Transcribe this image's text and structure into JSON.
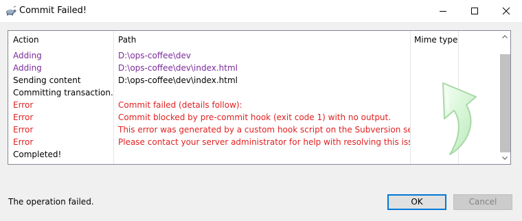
{
  "window": {
    "title": "Commit Failed!",
    "app_icon": "tortoise-icon",
    "controls": [
      "minimize-icon",
      "maximize-icon",
      "close-icon"
    ]
  },
  "list": {
    "headers": {
      "action": "Action",
      "path": "Path",
      "mime": "Mime type"
    },
    "rows": [
      {
        "type": "adding",
        "action": "Adding",
        "path": "D:\\ops-coffee\\dev"
      },
      {
        "type": "adding",
        "action": "Adding",
        "path": "D:\\ops-coffee\\dev\\index.html"
      },
      {
        "type": "normal",
        "action": "Sending content",
        "path": "D:\\ops-coffee\\dev\\index.html"
      },
      {
        "type": "normal",
        "action": "Committing transaction...",
        "path": ""
      },
      {
        "type": "error",
        "action": "Error",
        "path": "Commit failed (details follow):"
      },
      {
        "type": "error",
        "action": "Error",
        "path": "Commit blocked by pre-commit hook (exit code 1) with no output."
      },
      {
        "type": "error",
        "action": "Error",
        "path": "This error was generated by a custom hook script on the Subversion server."
      },
      {
        "type": "error",
        "action": "Error",
        "path": "Please contact your server administrator for help with resolving this issue."
      },
      {
        "type": "normal",
        "action": "Completed!",
        "path": ""
      }
    ],
    "colors": {
      "adding": "#7b2a9a",
      "normal": "#000000",
      "error": "#e02020"
    },
    "status_icon": "commit-arrow-icon"
  },
  "footer": {
    "status": "The operation failed.",
    "ok_label": "OK",
    "cancel_label": "Cancel"
  }
}
